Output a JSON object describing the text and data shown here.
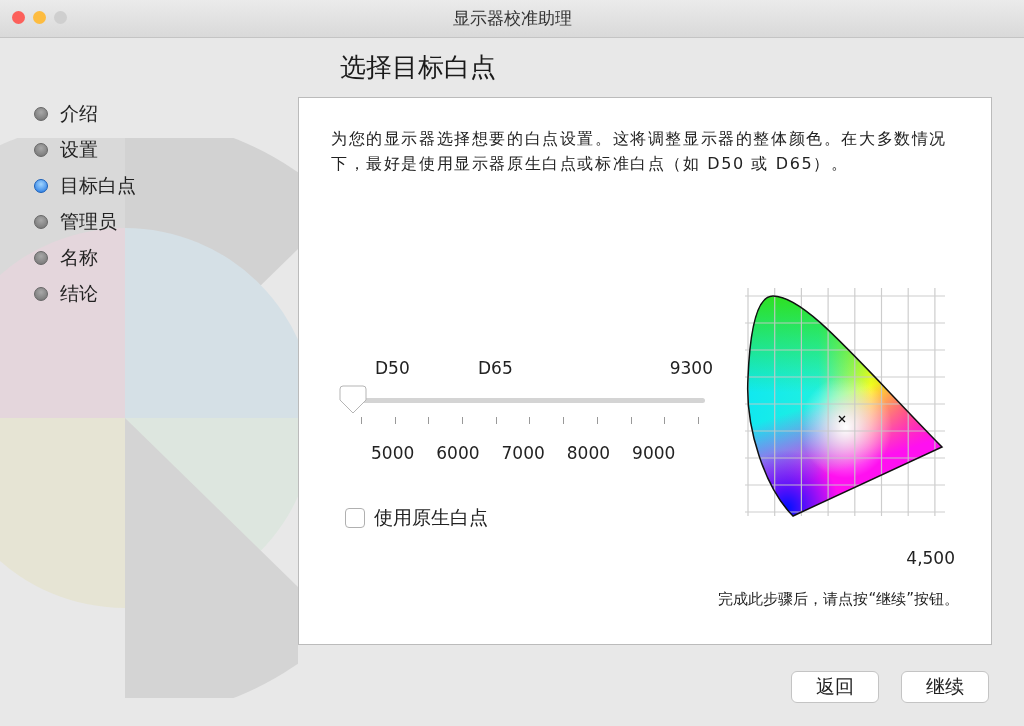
{
  "window": {
    "title": "显示器校准助理"
  },
  "steps": [
    {
      "label": "介绍",
      "selected": false
    },
    {
      "label": "设置",
      "selected": false
    },
    {
      "label": "目标白点",
      "selected": true
    },
    {
      "label": "管理员",
      "selected": false
    },
    {
      "label": "名称",
      "selected": false
    },
    {
      "label": "结论",
      "selected": false
    }
  ],
  "heading": "选择目标白点",
  "description": "为您的显示器选择想要的白点设置。这将调整显示器的整体颜色。在大多数情况下，最好是使用显示器原生白点或标准白点（如 D50 或 D65）。",
  "slider": {
    "markers": [
      "D50",
      "D65",
      "9300"
    ],
    "level": 0,
    "scale": [
      "5000",
      "6000",
      "7000",
      "8000",
      "9000"
    ]
  },
  "native_white_point": {
    "label": "使用原生白点",
    "checked": false
  },
  "gamut": {
    "reading": "4,500"
  },
  "hint": "完成此步骤后，请点按“继续”按钮。",
  "buttons": [
    {
      "label": "返回"
    },
    {
      "label": "继续"
    }
  ]
}
